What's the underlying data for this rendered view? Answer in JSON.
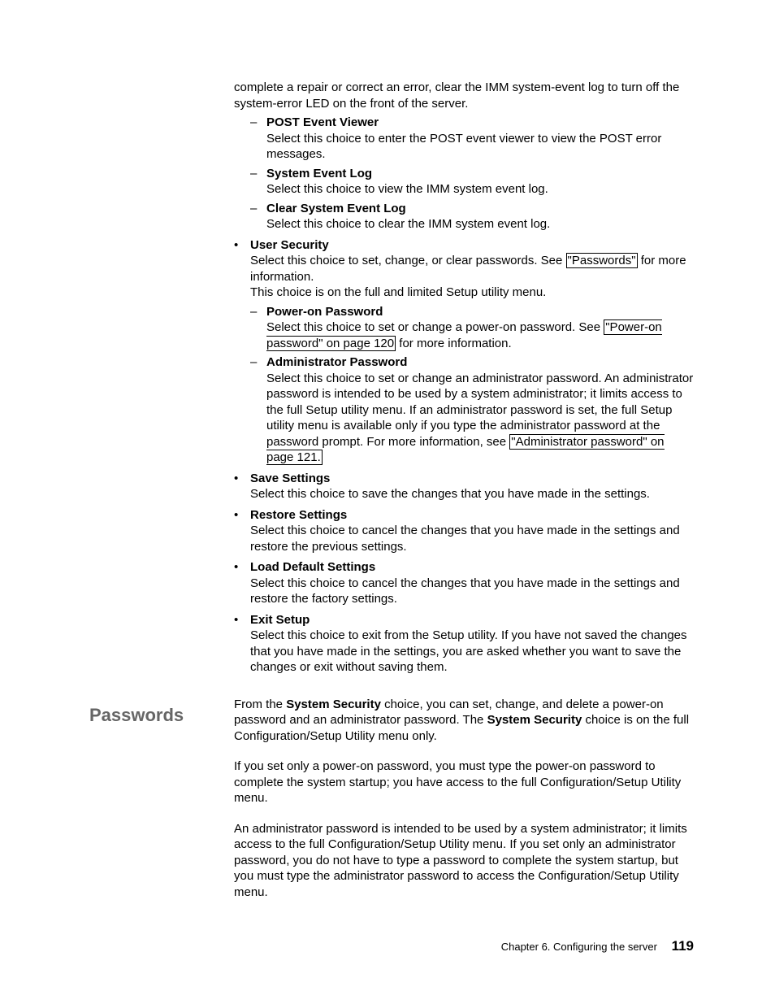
{
  "intro_para": "complete a repair or correct an error, clear the IMM system-event log to turn off the system-error LED on the front of the server.",
  "dash_post": {
    "title": "POST Event Viewer",
    "body": "Select this choice to enter the POST event viewer to view the POST error messages."
  },
  "dash_syslog": {
    "title": "System Event Log",
    "body": "Select this choice to view the IMM system event log."
  },
  "dash_clear": {
    "title": "Clear System Event Log",
    "body": "Select this choice to clear the IMM system event log."
  },
  "user_security": {
    "title": "User Security",
    "body1_a": "Select this choice to set, change, or clear passwords. See ",
    "body1_link": "\"Passwords\"",
    "body1_b": " for more information.",
    "body2": "This choice is on the full and limited Setup utility menu."
  },
  "dash_poweron": {
    "title": "Power-on Password",
    "body_a": "Select this choice to set or change a power-on password. See ",
    "body_link": "\"Power-on password\" on page 120",
    "body_b": " for more information."
  },
  "dash_admin": {
    "title": "Administrator Password",
    "body_a": "Select this choice to set or change an administrator password. An administrator password is intended to be used by a system administrator; it limits access to the full Setup utility menu. If an administrator password is set, the full Setup utility menu is available only if you type the administrator password at the password prompt. For more information, see ",
    "body_link": "\"Administrator password\" on page 121.",
    "body_b": ""
  },
  "save": {
    "title": "Save Settings",
    "body": "Select this choice to save the changes that you have made in the settings."
  },
  "restore": {
    "title": "Restore Settings",
    "body": "Select this choice to cancel the changes that you have made in the settings and restore the previous settings."
  },
  "load_default": {
    "title": "Load Default Settings",
    "body": "Select this choice to cancel the changes that you have made in the settings and restore the factory settings."
  },
  "exit": {
    "title": "Exit Setup",
    "body": "Select this choice to exit from the Setup utility. If you have not saved the changes that you have made in the settings, you are asked whether you want to save the changes or exit without saving them."
  },
  "heading_passwords": "Passwords",
  "pw_para1_a": "From the ",
  "pw_para1_b": "System Security",
  "pw_para1_c": " choice, you can set, change, and delete a power-on password and an administrator password. The ",
  "pw_para1_d": "System Security",
  "pw_para1_e": " choice is on the full Configuration/Setup Utility menu only.",
  "pw_para2": "If you set only a power-on password, you must type the power-on password to complete the system startup; you have access to the full Configuration/Setup Utility menu.",
  "pw_para3": "An administrator password is intended to be used by a system administrator; it limits access to the full Configuration/Setup Utility menu. If you set only an administrator password, you do not have to type a password to complete the system startup, but you must type the administrator password to access the Configuration/Setup Utility menu.",
  "footer_chapter": "Chapter 6. Configuring the server",
  "footer_page": "119"
}
